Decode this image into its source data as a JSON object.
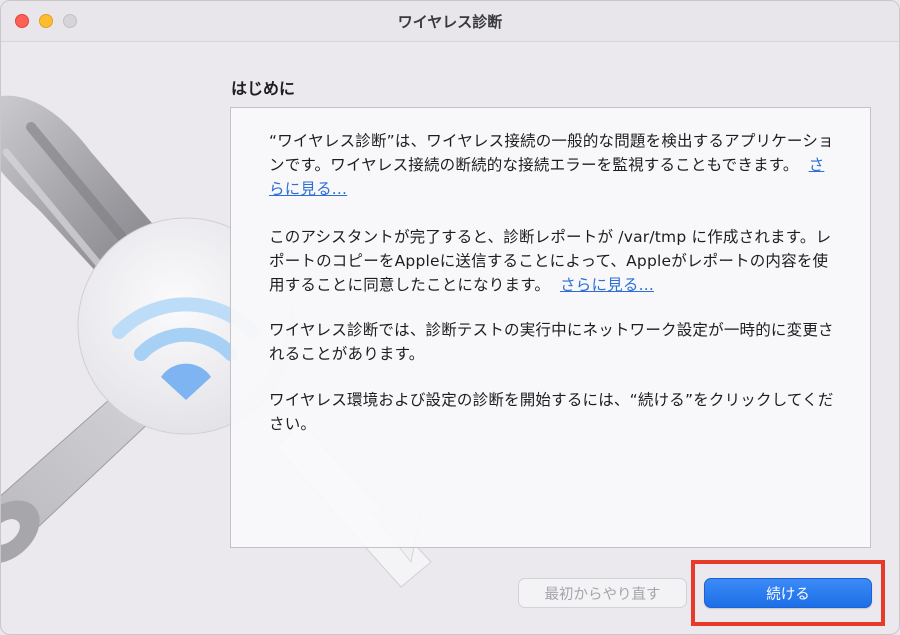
{
  "window": {
    "title": "ワイヤレス診断"
  },
  "section_heading": "はじめに",
  "paragraphs": {
    "p1_text": "“ワイヤレス診断”は、ワイヤレス接続の一般的な問題を検出するアプリケーションです。ワイヤレス接続の断続的な接続エラーを監視することもできます。",
    "p1_link": "さらに見る...",
    "p2_text": "このアシスタントが完了すると、診断レポートが /var/tmp に作成されます。レポートのコピーをAppleに送信することによって、Appleがレポートの内容を使用することに同意したことになります。",
    "p2_link": "さらに見る...",
    "p3_text": "ワイヤレス診断では、診断テストの実行中にネットワーク設定が一時的に変更されることがあります。",
    "p4_text": "ワイヤレス環境および設定の診断を開始するには、“続ける”をクリックしてください。"
  },
  "buttons": {
    "start_over_label": "最初からやり直す",
    "continue_label": "続ける"
  },
  "colors": {
    "accent": "#1d6fe8",
    "link": "#2b6fd6",
    "highlight": "#e63a2b"
  },
  "icons": [
    "wrench-icon",
    "screwdriver-icon",
    "wifi-icon"
  ]
}
